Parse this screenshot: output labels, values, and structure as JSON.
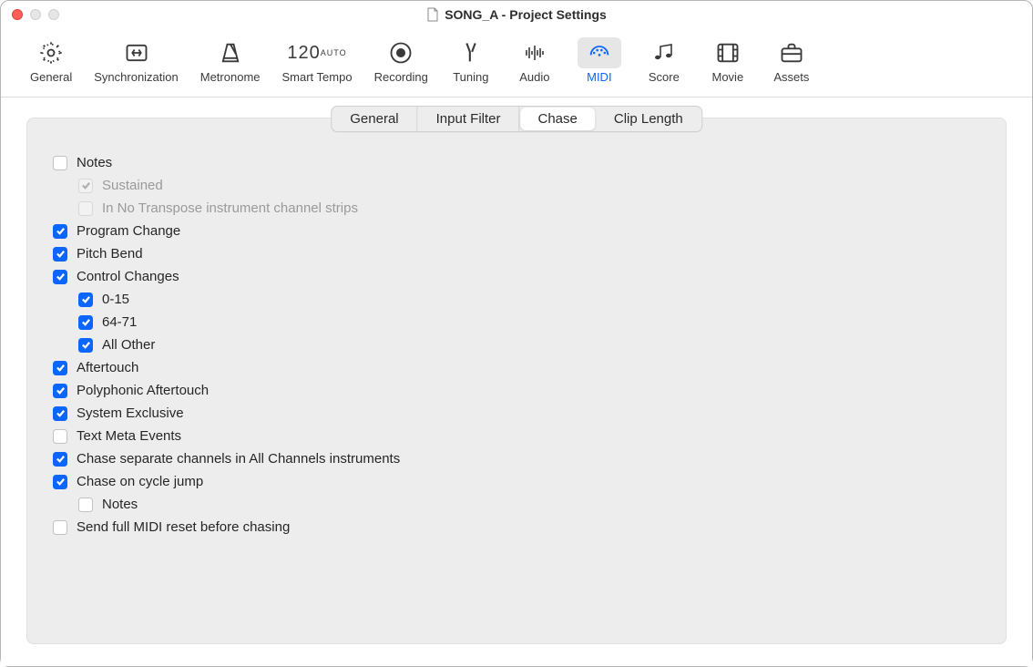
{
  "window": {
    "title": "SONG_A - Project Settings"
  },
  "toolbar": {
    "general": "General",
    "synchronization": "Synchronization",
    "metronome": "Metronome",
    "smart_tempo": "Smart Tempo",
    "smart_tempo_num": "120",
    "smart_tempo_auto": "AUTO",
    "recording": "Recording",
    "tuning": "Tuning",
    "audio": "Audio",
    "midi": "MIDI",
    "score": "Score",
    "movie": "Movie",
    "assets": "Assets"
  },
  "subtabs": {
    "general": "General",
    "input_filter": "Input Filter",
    "chase": "Chase",
    "clip_length": "Clip Length"
  },
  "options": {
    "notes": "Notes",
    "sustained": "Sustained",
    "in_no_transpose": "In No Transpose instrument channel strips",
    "program_change": "Program Change",
    "pitch_bend": "Pitch Bend",
    "control_changes": "Control Changes",
    "cc_0_15": "0-15",
    "cc_64_71": "64-71",
    "cc_all_other": "All Other",
    "aftertouch": "Aftertouch",
    "poly_aftertouch": "Polyphonic Aftertouch",
    "sysex": "System Exclusive",
    "text_meta": "Text Meta Events",
    "chase_separate": "Chase separate channels in All Channels instruments",
    "chase_cycle": "Chase on cycle jump",
    "cycle_notes": "Notes",
    "send_full_reset": "Send full MIDI reset before chasing"
  }
}
